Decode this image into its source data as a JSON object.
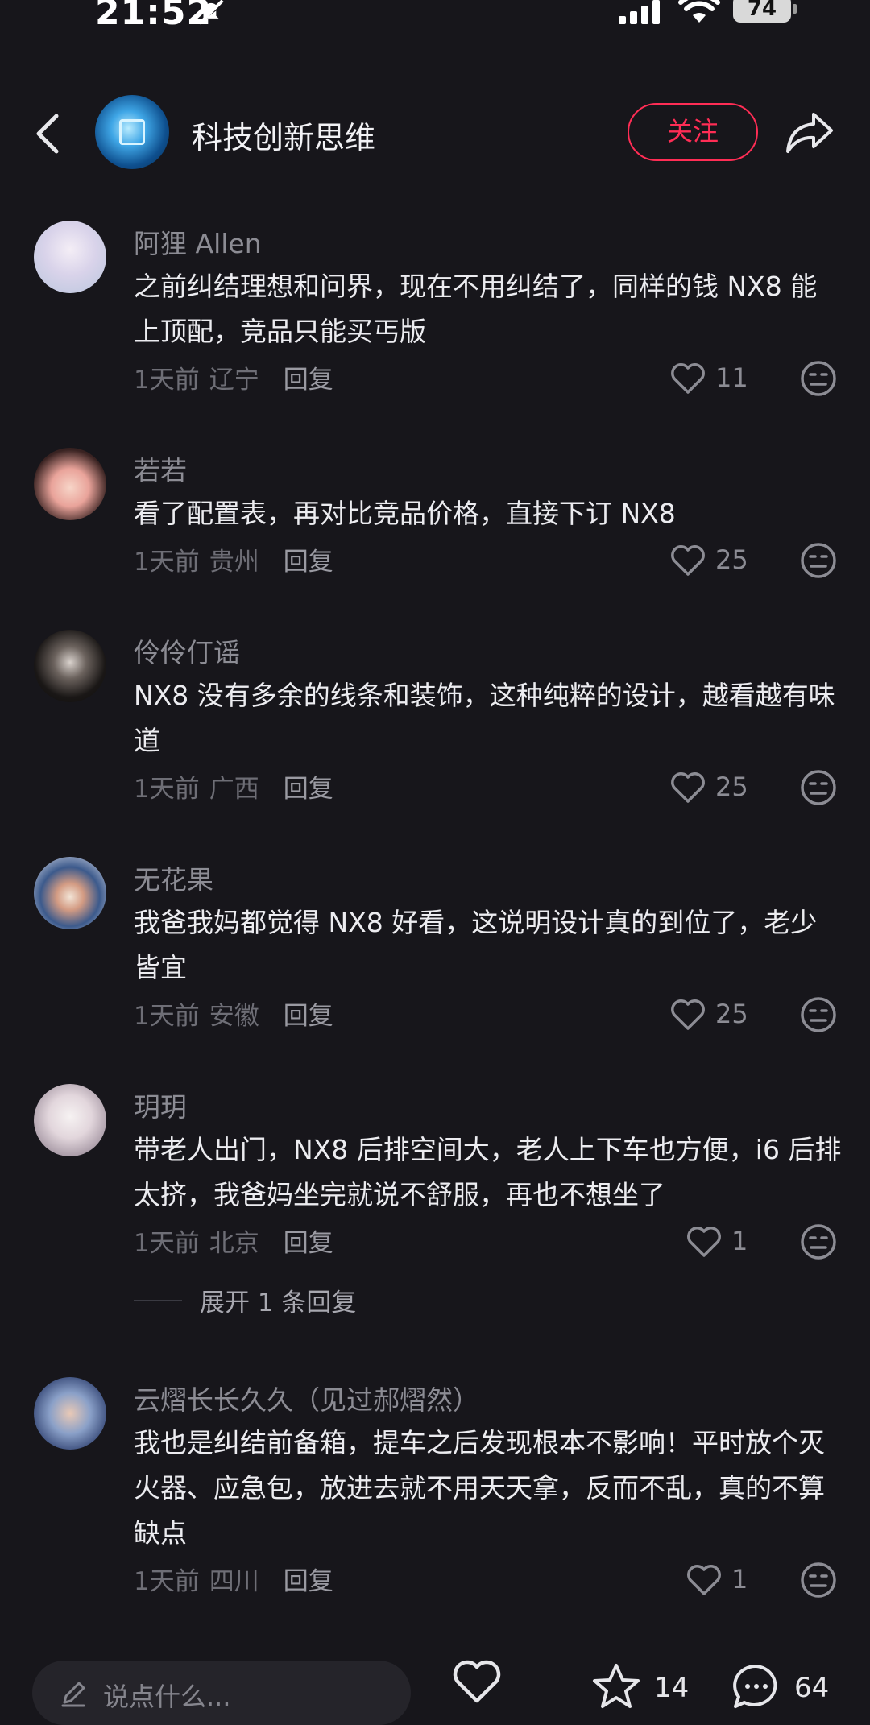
{
  "status_bar": {
    "time": "21:52",
    "battery": "74"
  },
  "header": {
    "channel_name": "科技创新思维",
    "follow_label": "关注"
  },
  "comments": [
    {
      "user": "阿狸 Allen",
      "text": "之前纠结理想和问界，现在不用纠结了，同样的钱 NX8 能上顶配，竞品只能买丐版",
      "time": "1天前",
      "location": "辽宁",
      "reply_label": "回复",
      "likes": "11"
    },
    {
      "user": "若若",
      "text": "看了配置表，再对比竞品价格，直接下订 NX8",
      "time": "1天前",
      "location": "贵州",
      "reply_label": "回复",
      "likes": "25"
    },
    {
      "user": "伶伶仃谣",
      "text": "NX8 没有多余的线条和装饰，这种纯粹的设计，越看越有味道",
      "time": "1天前",
      "location": "广西",
      "reply_label": "回复",
      "likes": "25"
    },
    {
      "user": "无花果",
      "text": "我爸我妈都觉得 NX8 好看，这说明设计真的到位了，老少皆宜",
      "time": "1天前",
      "location": "安徽",
      "reply_label": "回复",
      "likes": "25"
    },
    {
      "user": "玥玥",
      "text": "带老人出门，NX8 后排空间大，老人上下车也方便，i6 后排太挤，我爸妈坐完就说不舒服，再也不想坐了",
      "time": "1天前",
      "location": "北京",
      "reply_label": "回复",
      "likes": "1",
      "expand_label": "展开 1 条回复"
    },
    {
      "user": "云熠长长久久（见过郝熠然）",
      "text": "我也是纠结前备箱，提车之后发现根本不影响！平时放个灭火器、应急包，放进去就不用天天拿，反而不乱，真的不算缺点",
      "time": "1天前",
      "location": "四川",
      "reply_label": "回复",
      "likes": "1"
    }
  ],
  "bottom_bar": {
    "input_placeholder": "说点什么...",
    "star_count": "14",
    "comment_count": "64"
  },
  "colors": {
    "background": "#17161b",
    "accent": "#ff2d55"
  }
}
